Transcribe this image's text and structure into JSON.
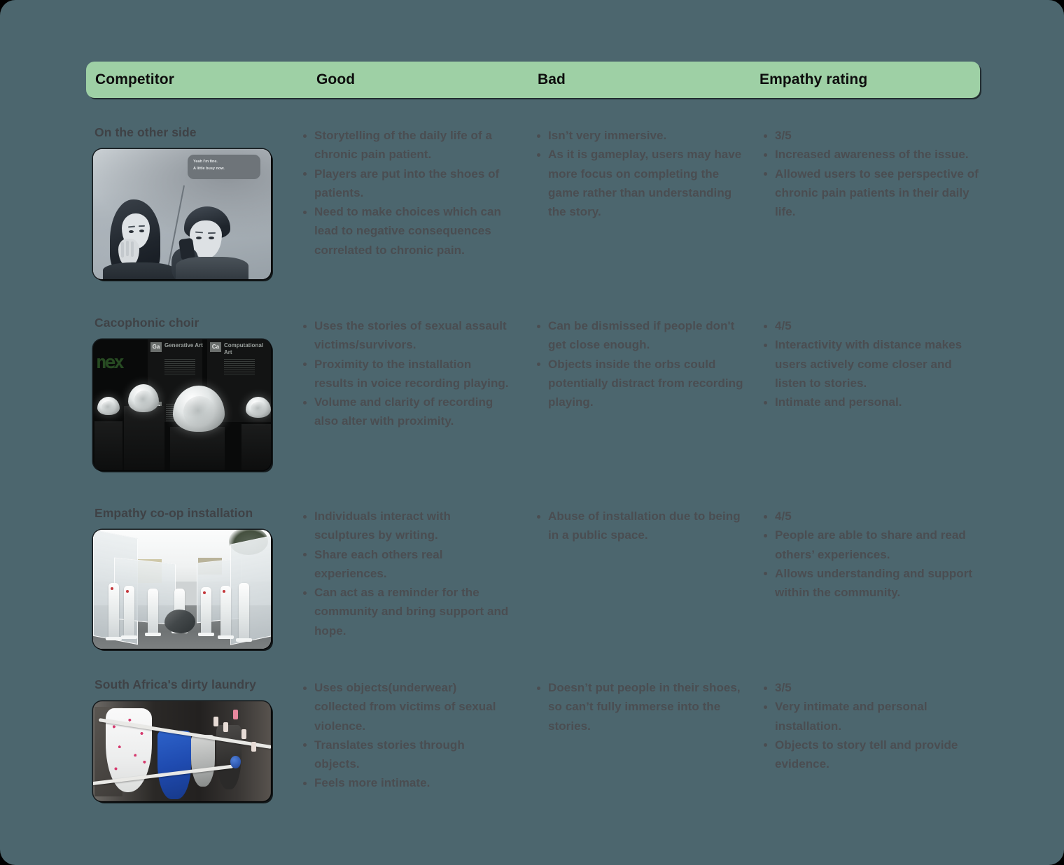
{
  "table": {
    "headers": [
      {
        "id": "competitor",
        "label": "Competitor"
      },
      {
        "id": "good",
        "label": "Good"
      },
      {
        "id": "bad",
        "label": "Bad"
      },
      {
        "id": "rating",
        "label": "Empathy rating"
      }
    ],
    "header_background": "#9ed0a5",
    "page_background": "#4c666e",
    "text_color": "#4a4d51",
    "rows": [
      {
        "competitor": "On the other side",
        "image": {
          "name": "on-the-other-side-comic-thumbnail",
          "caption_lines": [
            "Yeah I'm fine.",
            "A little busy now."
          ]
        },
        "good": [
          "Storytelling of the daily life of a chronic pain patient.",
          "Players are put into the shoes of patients.",
          " Need to make choices which can lead to negative consequences correlated to chronic pain."
        ],
        "bad": [
          "Isn’t very immersive.",
          "As it is gameplay, users may have more focus on completing the game rather than understanding the story."
        ],
        "rating": [
          "3/5",
          "Increased awareness of the issue.",
          "Allowed users to see perspective of chronic pain patients in their daily life."
        ]
      },
      {
        "competitor": "Cacophonic choir",
        "image": {
          "name": "cacophonic-choir-exhibition-thumbnail",
          "exhibit_labels": [
            {
              "symbol": "Ga",
              "label": "Generative Art"
            },
            {
              "symbol": "Ca",
              "label": "Computational Art"
            },
            {
              "symbol": "Mp",
              "label": ""
            }
          ]
        },
        "good": [
          "Uses the stories of sexual assault victims/survivors.",
          "Proximity to the installation results in voice recording playing.",
          "Volume and clarity of recording also alter with proximity."
        ],
        "bad": [
          "Can be dismissed if people don't get close enough.",
          "Objects inside the orbs could potentially distract from recording playing."
        ],
        "rating": [
          "4/5",
          "Interactivity with distance makes users actively come closer and listen to stories.",
          "Intimate and personal."
        ]
      },
      {
        "competitor": "Empathy co-op installation",
        "image": {
          "name": "empathy-coop-installation-thumbnail",
          "exhibit_labels": []
        },
        "good": [
          "Individuals interact with sculptures by writing.",
          "Share each others real experiences.",
          "Can act as a reminder for the community and bring support and hope."
        ],
        "bad": [
          "Abuse of installation due to being in a public space."
        ],
        "rating": [
          "4/5",
          "People are able to share and read others’ experiences.",
          "Allows understanding and support within the community."
        ]
      },
      {
        "competitor": "South Africa's dirty laundry",
        "image": {
          "name": "south-africa-dirty-laundry-thumbnail",
          "exhibit_labels": []
        },
        "good": [
          "Uses objects(underwear) collected from victims of sexual violence.",
          "Translates stories through objects.",
          "Feels more intimate."
        ],
        "bad": [
          "Doesn’t put people in their shoes, so can’t fully immerse into the stories."
        ],
        "rating": [
          "3/5",
          "Very intimate and personal installation.",
          "Objects to story tell and provide evidence."
        ]
      }
    ]
  }
}
